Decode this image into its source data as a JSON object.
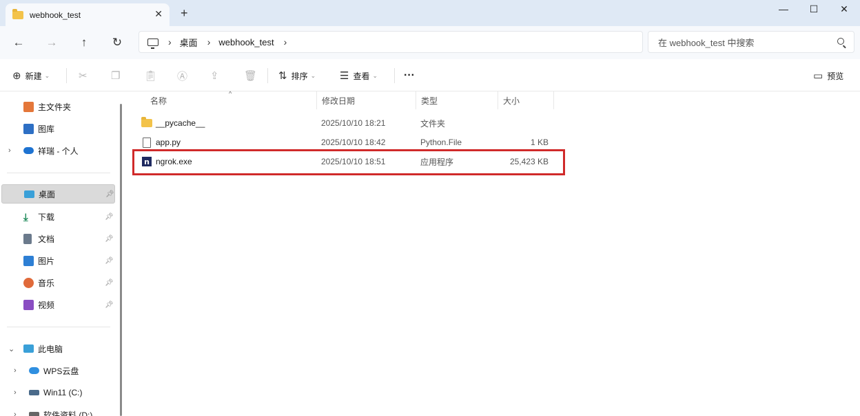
{
  "window": {
    "tab_title": "webhook_test",
    "tab_close": "✕",
    "new_tab": "+",
    "minimize": "—",
    "maximize": "☐",
    "close": "✕"
  },
  "nav": {
    "back": "←",
    "forward": "→",
    "up": "↑",
    "refresh": "↻",
    "breadcrumb": [
      "桌面",
      "webhook_test"
    ],
    "search_placeholder": "在 webhook_test 中搜索"
  },
  "toolbar": {
    "new_label": "新建",
    "sort_label": "排序",
    "view_label": "查看",
    "more_label": "···",
    "preview_label": "预览"
  },
  "sidebar": {
    "top_items": [
      {
        "label": "主文件夹",
        "icon": "home-icon",
        "color": "#e4773a"
      },
      {
        "label": "图库",
        "icon": "gallery-icon",
        "color": "#2d6fc4"
      },
      {
        "label": "祥瑞 - 个人",
        "icon": "onedrive-icon",
        "color": "#1e73d1"
      }
    ],
    "quick_items": [
      {
        "label": "桌面",
        "icon": "desktop-icon",
        "color": "#3aa0d8"
      },
      {
        "label": "下载",
        "icon": "download-icon",
        "color": "#1f8a5a"
      },
      {
        "label": "文档",
        "icon": "document-icon",
        "color": "#6b7a8c"
      },
      {
        "label": "图片",
        "icon": "pictures-icon",
        "color": "#2d7fd4"
      },
      {
        "label": "音乐",
        "icon": "music-icon",
        "color": "#e06a3a"
      },
      {
        "label": "视频",
        "icon": "video-icon",
        "color": "#8a4dc2"
      }
    ],
    "pc_items": [
      {
        "label": "此电脑",
        "icon": "this-pc-icon",
        "color": "#3aa0d8"
      },
      {
        "label": "WPS云盘",
        "icon": "cloud-icon",
        "color": "#2f8fe0"
      },
      {
        "label": "Win11 (C:)",
        "icon": "drive-icon",
        "color": "#4a6a8a"
      },
      {
        "label": "软件资料 (D:)",
        "icon": "drive-icon",
        "color": "#666666"
      }
    ]
  },
  "columns": {
    "name": "名称",
    "date": "修改日期",
    "type": "类型",
    "size": "大小"
  },
  "files": [
    {
      "name": "__pycache__",
      "date": "2025/10/10 18:21",
      "type": "文件夹",
      "size": ""
    },
    {
      "name": "app.py",
      "date": "2025/10/10 18:42",
      "type": "Python.File",
      "size": "1 KB"
    },
    {
      "name": "ngrok.exe",
      "date": "2025/10/10 18:51",
      "type": "应用程序",
      "size": "25,423 KB"
    }
  ],
  "colors": {
    "highlight_border": "#d02a2a",
    "titlebar_bg": "#dfe9f5",
    "folder_yellow": "#f3c34a"
  }
}
